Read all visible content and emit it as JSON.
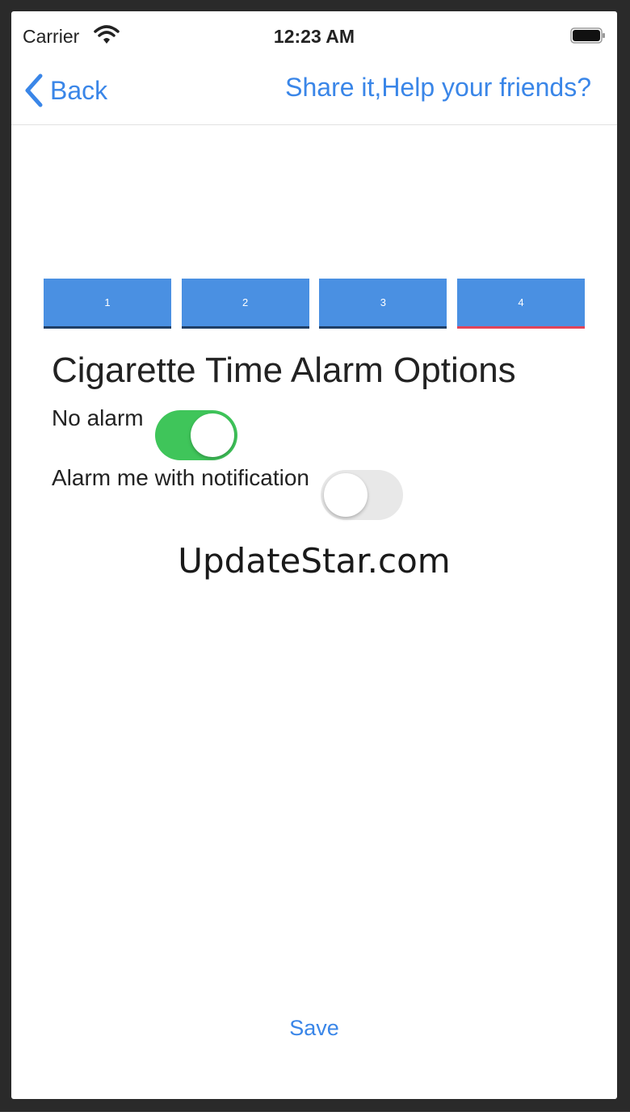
{
  "status_bar": {
    "carrier": "Carrier",
    "time": "12:23 AM"
  },
  "nav": {
    "back_label": "Back",
    "share_label": "Share it,Help your friends?"
  },
  "steps": [
    {
      "label": "1",
      "active": false
    },
    {
      "label": "2",
      "active": false
    },
    {
      "label": "3",
      "active": false
    },
    {
      "label": "4",
      "active": true
    }
  ],
  "heading": "Cigarette Time Alarm Options",
  "options": [
    {
      "label": "No alarm",
      "enabled": true
    },
    {
      "label": "Alarm me with notification",
      "enabled": false
    }
  ],
  "watermark": "UpdateStar.com",
  "save_label": "Save",
  "colors": {
    "accent": "#3a86e8",
    "step_fill": "#4a90e2",
    "active_step_underline": "#e0445a",
    "switch_on": "#3fc55a",
    "switch_off": "#e8e8e8"
  },
  "icons": [
    "wifi-icon",
    "battery-icon",
    "chevron-left-icon"
  ]
}
